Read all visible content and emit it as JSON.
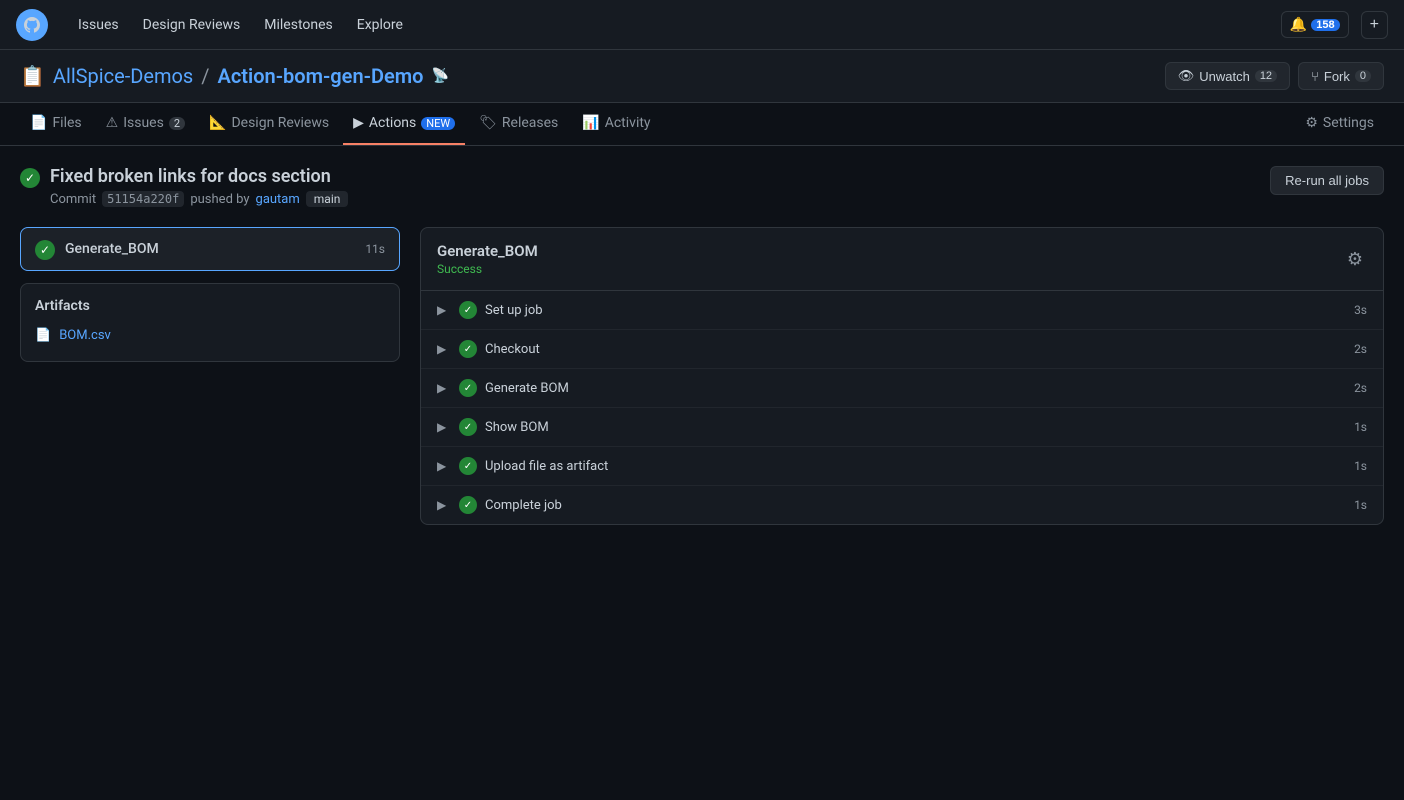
{
  "topNav": {
    "links": [
      "Issues",
      "Design Reviews",
      "Milestones",
      "Explore"
    ],
    "notificationCount": "158",
    "plusLabel": "+"
  },
  "repoHeader": {
    "icon": "📋",
    "owner": "AllSpice-Demos",
    "separator": "/",
    "repoName": "Action-bom-gen-Demo",
    "feedIcon": "📡",
    "unwatchLabel": "Unwatch",
    "watchCount": "12",
    "forkLabel": "Fork",
    "forkCount": "0"
  },
  "tabs": [
    {
      "id": "files",
      "label": "Files",
      "badge": null,
      "newBadge": null,
      "active": false
    },
    {
      "id": "issues",
      "label": "Issues",
      "badge": "2",
      "newBadge": null,
      "active": false
    },
    {
      "id": "design-reviews",
      "label": "Design Reviews",
      "badge": null,
      "newBadge": null,
      "active": false
    },
    {
      "id": "actions",
      "label": "Actions",
      "badge": null,
      "newBadge": "NEW",
      "active": true
    },
    {
      "id": "releases",
      "label": "Releases",
      "badge": null,
      "newBadge": null,
      "active": false
    },
    {
      "id": "activity",
      "label": "Activity",
      "badge": null,
      "newBadge": null,
      "active": false
    },
    {
      "id": "settings",
      "label": "Settings",
      "badge": null,
      "newBadge": null,
      "active": false
    }
  ],
  "workflow": {
    "title": "Fixed broken links for docs section",
    "commitHash": "51154a220f",
    "pushedBy": "pushed by",
    "author": "gautam",
    "branchBadge": "main",
    "rerunLabel": "Re-run all jobs"
  },
  "leftPanel": {
    "jobs": [
      {
        "id": "generate-bom",
        "name": "Generate_BOM",
        "duration": "11s",
        "active": true
      }
    ],
    "artifacts": {
      "title": "Artifacts",
      "items": [
        {
          "id": "bom-csv",
          "name": "BOM.csv"
        }
      ]
    }
  },
  "rightPanel": {
    "title": "Generate_BOM",
    "subtitle": "Success",
    "steps": [
      {
        "id": "set-up-job",
        "name": "Set up job",
        "duration": "3s"
      },
      {
        "id": "checkout",
        "name": "Checkout",
        "duration": "2s"
      },
      {
        "id": "generate-bom",
        "name": "Generate BOM",
        "duration": "2s"
      },
      {
        "id": "show-bom",
        "name": "Show BOM",
        "duration": "1s"
      },
      {
        "id": "upload-file",
        "name": "Upload file as artifact",
        "duration": "1s"
      },
      {
        "id": "complete-job",
        "name": "Complete job",
        "duration": "1s"
      }
    ]
  }
}
